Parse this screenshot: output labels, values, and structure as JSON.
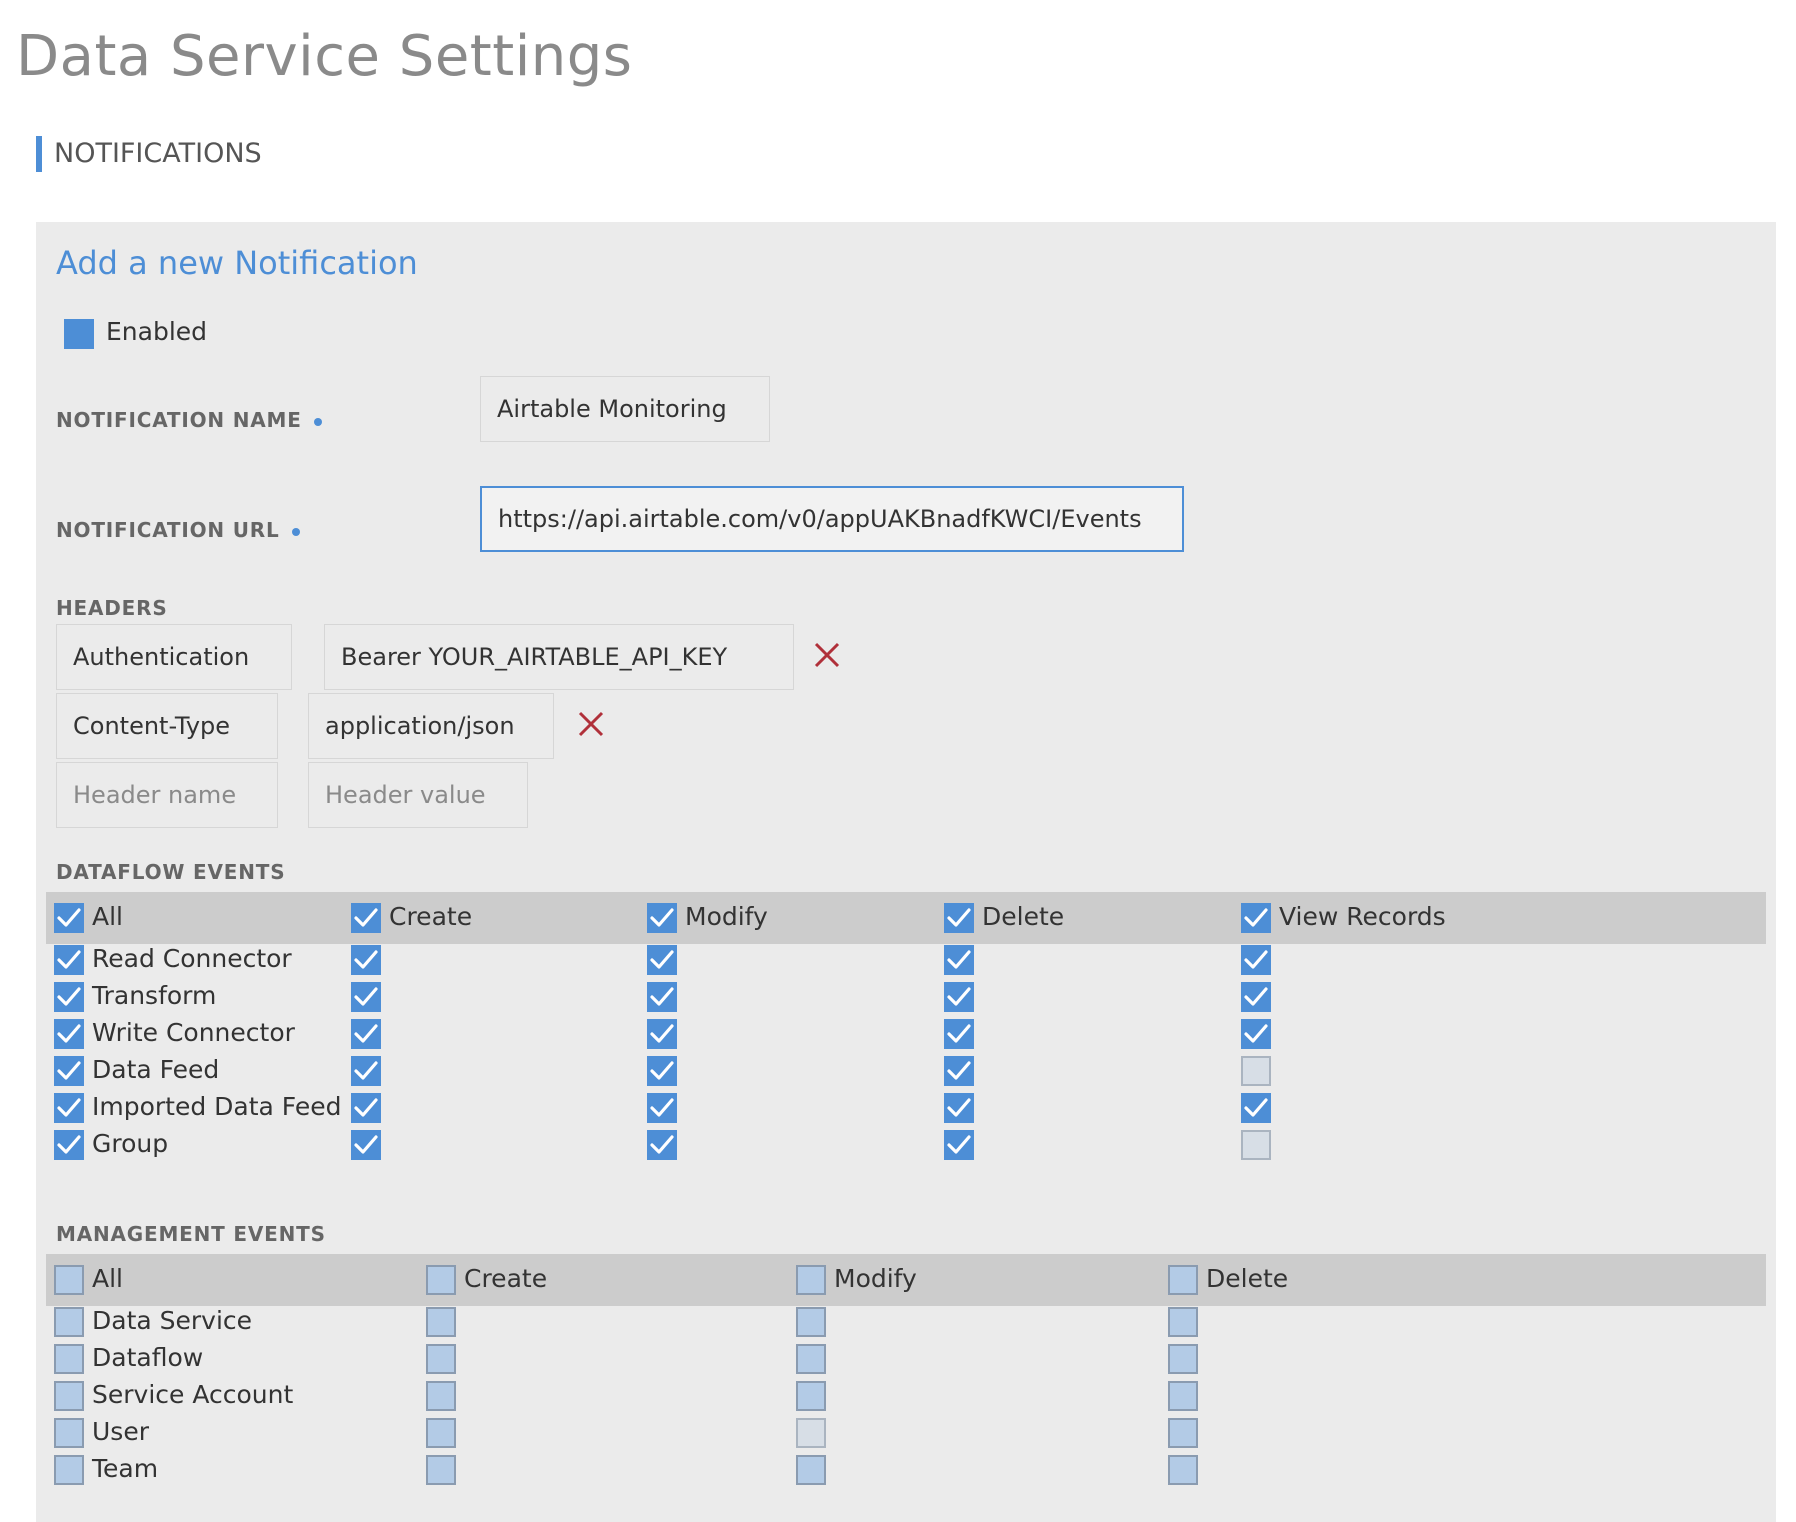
{
  "page": {
    "title": "Data Service Settings",
    "section": "NOTIFICATIONS"
  },
  "form": {
    "heading": "Add a new Notification",
    "enabled": {
      "label": "Enabled",
      "checked": true
    },
    "name": {
      "label": "NOTIFICATION NAME",
      "value": "Airtable Monitoring"
    },
    "url": {
      "label": "NOTIFICATION URL",
      "value": "https://api.airtable.com/v0/appUAKBnadfKWCI/Events"
    },
    "headers": {
      "label": "HEADERS",
      "rows": [
        {
          "name": "Authentication",
          "value": "Bearer YOUR_AIRTABLE_API_KEY"
        },
        {
          "name": "Content-Type",
          "value": "application/json"
        }
      ],
      "name_placeholder": "Header name",
      "value_placeholder": "Header value"
    }
  },
  "dataflow": {
    "label": "DATAFLOW EVENTS",
    "columns": [
      "Create",
      "Modify",
      "Delete",
      "View Records"
    ],
    "header": {
      "label": "All",
      "checks": [
        "on",
        "on",
        "on",
        "on",
        "on"
      ]
    },
    "rows": [
      {
        "label": "Read Connector",
        "checks": [
          "on",
          "on",
          "on",
          "on",
          "on"
        ]
      },
      {
        "label": "Transform",
        "checks": [
          "on",
          "on",
          "on",
          "on",
          "on"
        ]
      },
      {
        "label": "Write Connector",
        "checks": [
          "on",
          "on",
          "on",
          "on",
          "on"
        ]
      },
      {
        "label": "Data Feed",
        "checks": [
          "on",
          "on",
          "on",
          "on",
          "dis"
        ]
      },
      {
        "label": "Imported Data Feed",
        "checks": [
          "on",
          "on",
          "on",
          "on",
          "on"
        ]
      },
      {
        "label": "Group",
        "checks": [
          "on",
          "on",
          "on",
          "on",
          "dis"
        ]
      }
    ]
  },
  "management": {
    "label": "MANAGEMENT EVENTS",
    "columns": [
      "Create",
      "Modify",
      "Delete"
    ],
    "header": {
      "label": "All",
      "checks": [
        "off",
        "off",
        "off",
        "off"
      ]
    },
    "rows": [
      {
        "label": "Data Service",
        "checks": [
          "off",
          "off",
          "off",
          "off"
        ]
      },
      {
        "label": "Dataflow",
        "checks": [
          "off",
          "off",
          "off",
          "off"
        ]
      },
      {
        "label": "Service Account",
        "checks": [
          "off",
          "off",
          "off",
          "off"
        ]
      },
      {
        "label": "User",
        "checks": [
          "off",
          "off",
          "dis",
          "off"
        ]
      },
      {
        "label": "Team",
        "checks": [
          "off",
          "off",
          "off",
          "off"
        ]
      }
    ]
  },
  "colors": {
    "accent": "#4d8ed6",
    "panel": "#ebebeb",
    "band": "#cccccc",
    "remove": "#b0303a"
  },
  "icons": {
    "check": "checkmark-icon",
    "remove": "close-x-icon"
  }
}
